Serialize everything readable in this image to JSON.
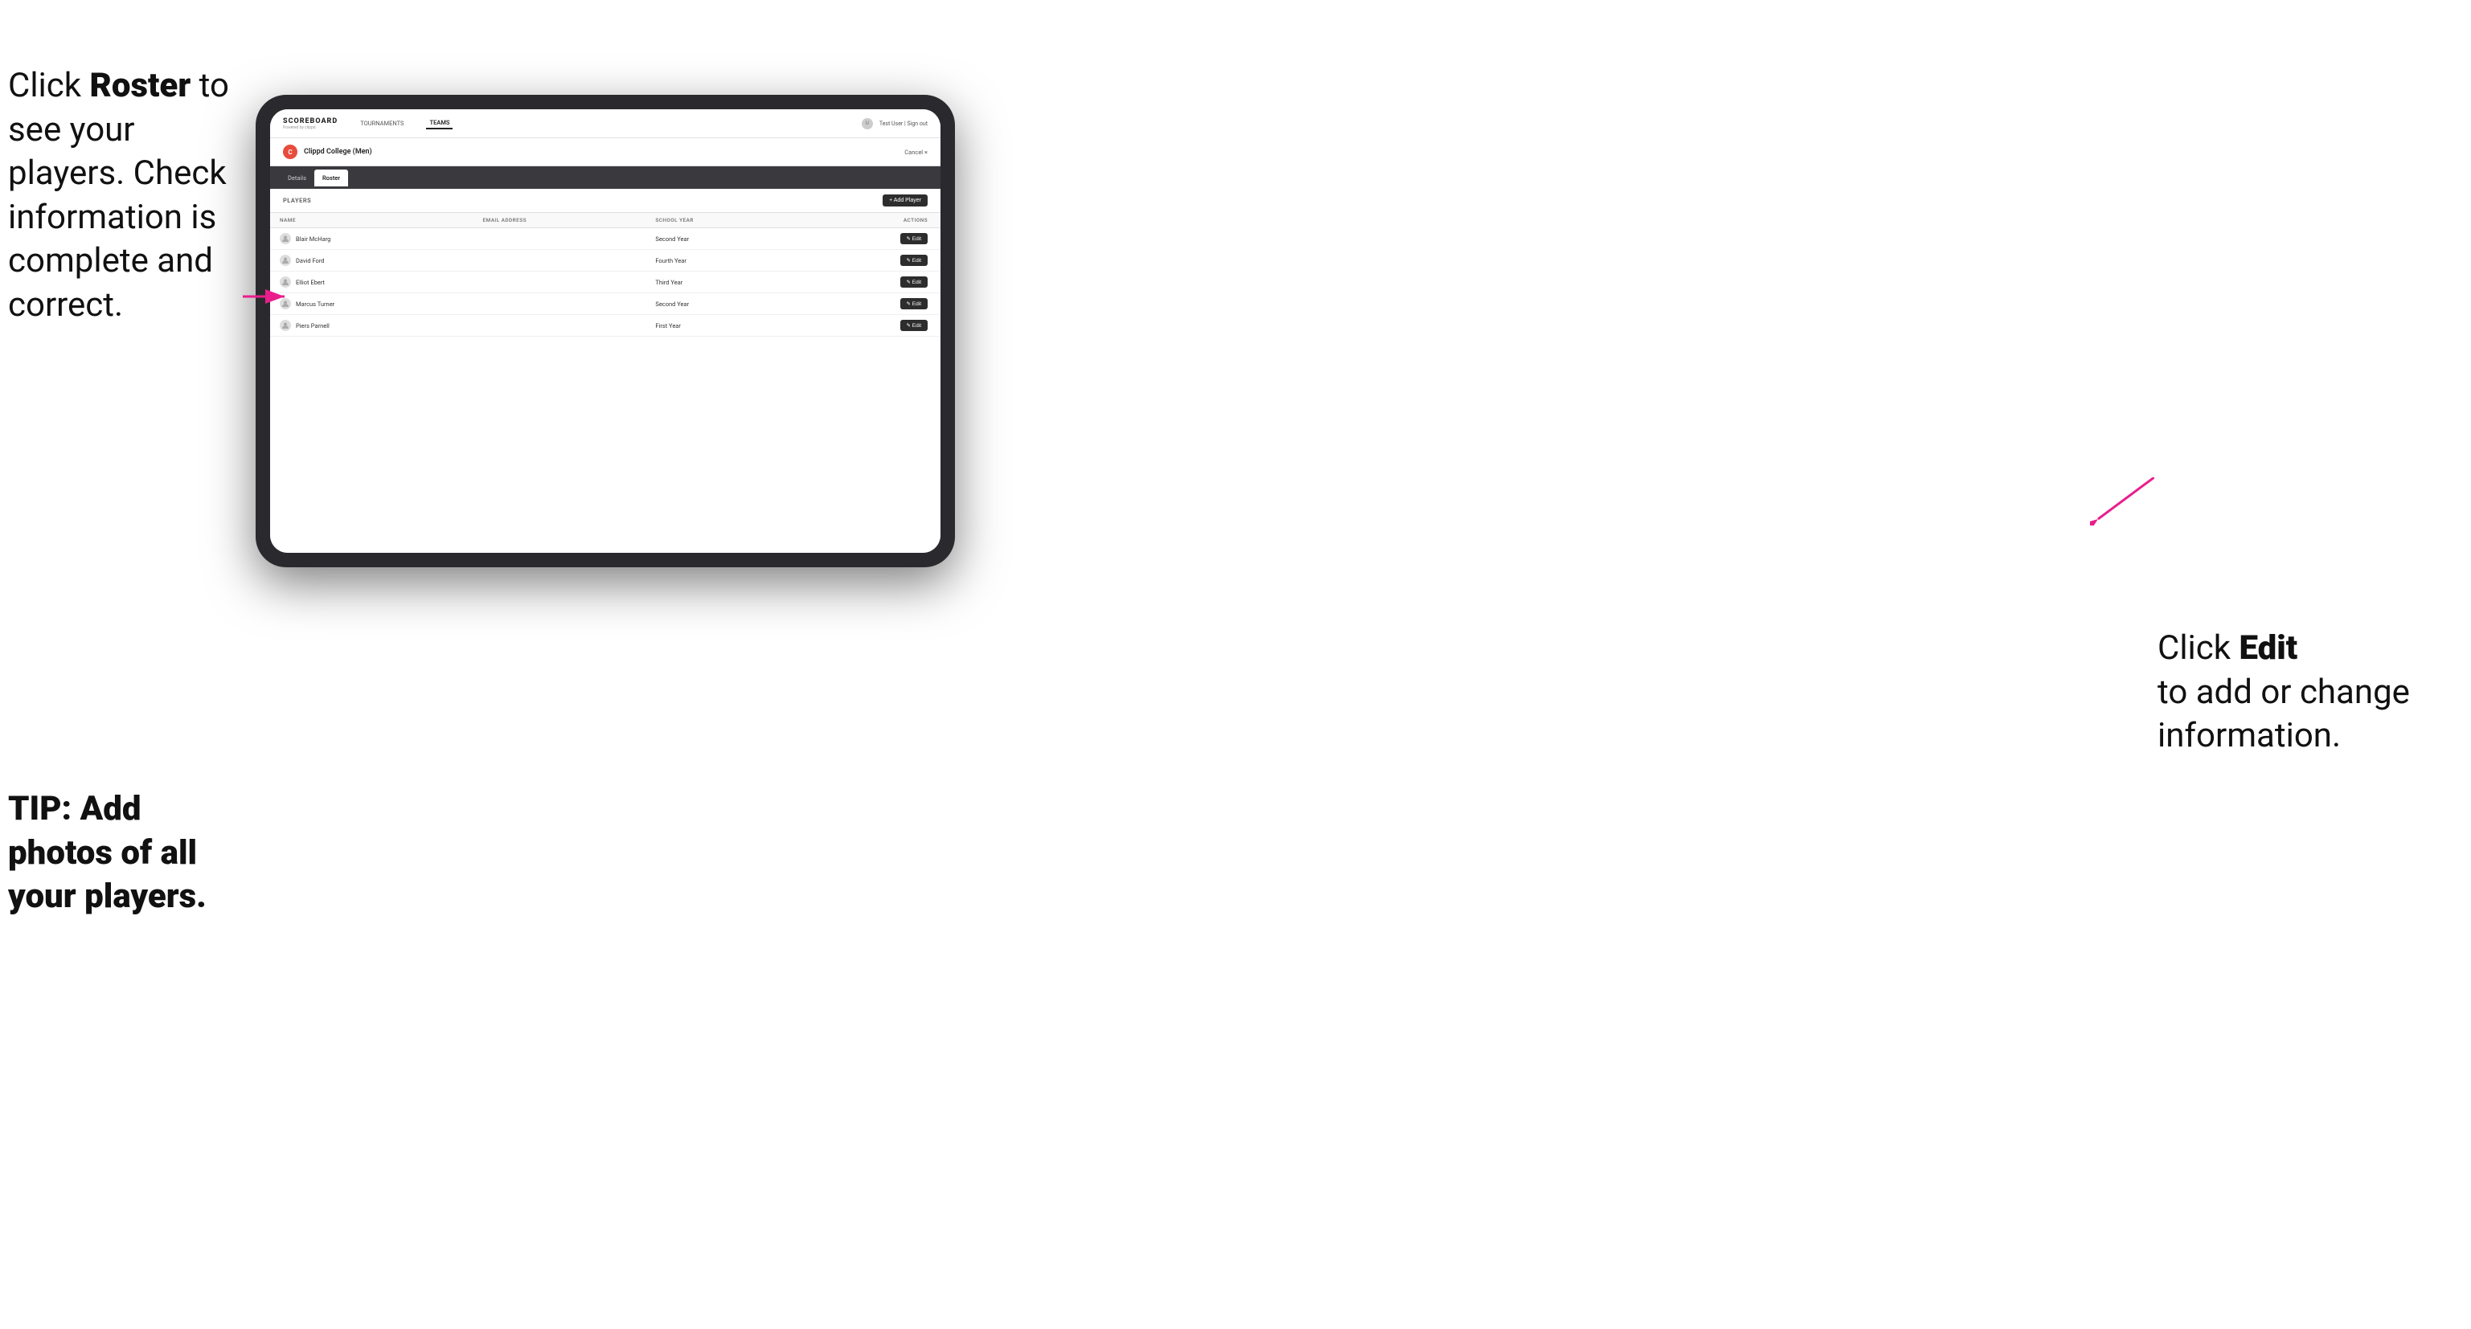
{
  "page": {
    "instructions_left_line1": "Click ",
    "instructions_left_bold": "Roster",
    "instructions_left_line2": " to",
    "instructions_left_rest": "see your players.\nCheck information\nis complete and\ncorrect.",
    "tip_text": "TIP: Add photos of\nall your players.",
    "instructions_right_pre": "Click ",
    "instructions_right_bold": "Edit",
    "instructions_right_post": "\nto add or change\ninformation."
  },
  "app_bar": {
    "logo": "SCOREBOARD",
    "logo_sub": "Powered by clippd",
    "nav_items": [
      "TOURNAMENTS",
      "TEAMS"
    ],
    "active_nav": "TEAMS",
    "user_text": "Test User | Sign out"
  },
  "team_header": {
    "logo_letter": "C",
    "team_name": "Clippd College (Men)",
    "cancel_label": "Cancel ×"
  },
  "tabs": [
    {
      "label": "Details",
      "active": false
    },
    {
      "label": "Roster",
      "active": true
    }
  ],
  "players_section": {
    "section_label": "PLAYERS",
    "add_button_label": "+ Add Player",
    "table_headers": {
      "name": "NAME",
      "email": "EMAIL ADDRESS",
      "school_year": "SCHOOL YEAR",
      "actions": "ACTIONS"
    },
    "players": [
      {
        "name": "Blair McHarg",
        "email": "",
        "school_year": "Second Year"
      },
      {
        "name": "David Ford",
        "email": "",
        "school_year": "Fourth Year"
      },
      {
        "name": "Elliot Ebert",
        "email": "",
        "school_year": "Third Year"
      },
      {
        "name": "Marcus Turner",
        "email": "",
        "school_year": "Second Year"
      },
      {
        "name": "Piers Parnell",
        "email": "",
        "school_year": "First Year"
      }
    ],
    "edit_label": "✎ Edit"
  }
}
